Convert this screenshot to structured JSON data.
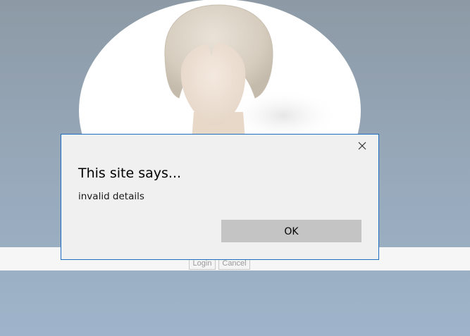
{
  "login_form": {
    "login_label": "Login",
    "cancel_label": "Cancel"
  },
  "dialog": {
    "title": "This site says...",
    "message": "invalid details",
    "ok_label": "OK",
    "close_icon": "close-icon"
  },
  "colors": {
    "background_top": "#8d9aa6",
    "background_bottom": "#9fb4cb",
    "dialog_border": "#1f6dbf",
    "dialog_background": "#f0f0f0",
    "ok_button": "#c4c4c4"
  }
}
